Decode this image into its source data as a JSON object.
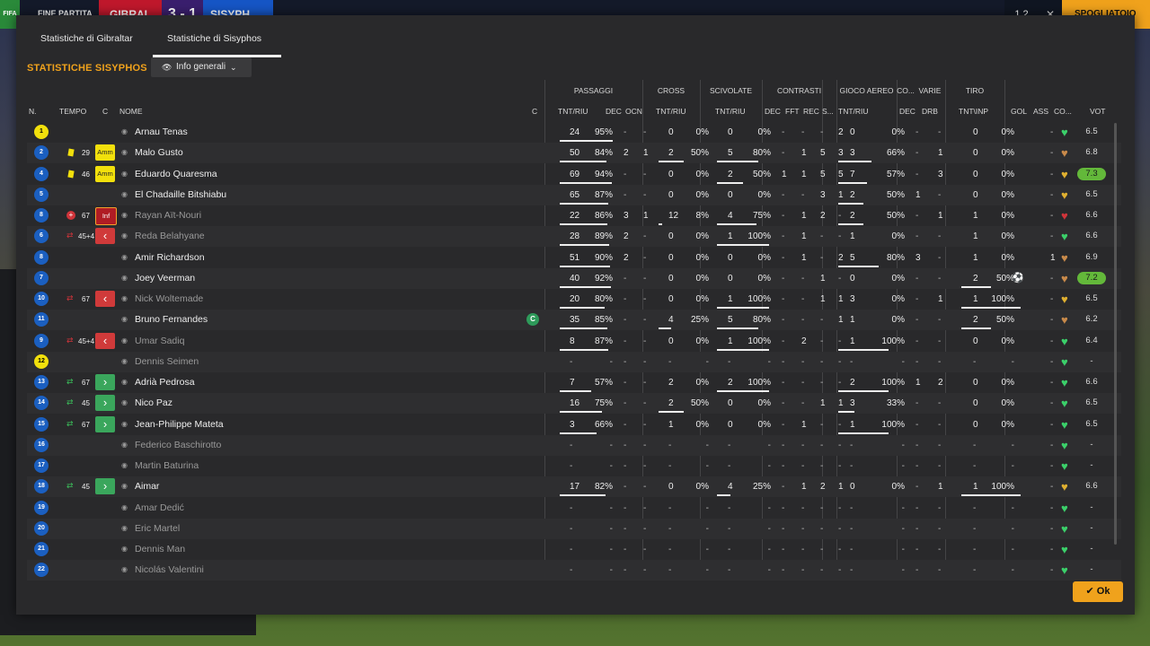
{
  "topbar": {
    "fifa": "FIFA",
    "match_label": "FINE PARTITA",
    "team1": "GIBRAL",
    "score": "3 - 1",
    "team2": "SISYPH",
    "btn1": "1 2",
    "close": "✕",
    "spogliatoio": "SPOGLIATOIO"
  },
  "tabs": [
    "Statistiche di Gibraltar",
    "Statistiche di Sisyphos"
  ],
  "stats_title": "STATISTICHE SISYPHOS",
  "view_dropdown": "Info generali",
  "groups": [
    "PASSAGGI",
    "CROSS",
    "SCIVOLATE",
    "CONTRASTI",
    "GIOCO AEREO",
    "CO...",
    "VARIE",
    "TIRO"
  ],
  "columns": [
    "N.",
    "TEMPO",
    "C",
    "NOME",
    "C",
    "TNT/RIU",
    "DEC",
    "OCN",
    "TNT/RIU",
    "TNT/RIU",
    "DEC",
    "FFT",
    "REC",
    "S...",
    "TNT/RIU",
    "DEC",
    "DRB",
    "TNT\\INP",
    "GOL",
    "ASS",
    "CO...",
    "VOT"
  ],
  "ok_label": "Ok",
  "colors": {
    "accent": "#f0a21c",
    "shirt_blue": "#1b5fc0",
    "goalkeeper": "#f2e00c",
    "rating_hi": "#63b83a"
  },
  "players": [
    {
      "num": "1",
      "gk": true,
      "time": "",
      "event": "",
      "badge": "",
      "name": "Arnau Tenas",
      "dim": false,
      "cap": false,
      "p_tnt": "24",
      "p_pct": "95%",
      "p_bar": 0.95,
      "p_dec": "-",
      "p_ocn": "-",
      "cr_tnt": "0",
      "cr_pct": "0%",
      "cr_bar": 0,
      "sc_tnt": "0",
      "sc_pct": "0%",
      "sc_bar": 0,
      "ct_dec": "-",
      "ct_fft": "-",
      "ct_rec": "-",
      "ct_s": "2",
      "ga_tnt": "0",
      "ga_pct": "0%",
      "ga_bar": 0,
      "co": "-",
      "drb": "-",
      "sh_tnt": "0",
      "sh_pct": "0%",
      "sh_bar": 0,
      "gol": "",
      "ass": "-",
      "heart": "#3bd06a",
      "vot": "6.5",
      "hi": false
    },
    {
      "num": "2",
      "gk": false,
      "time": "29",
      "event": "ycard",
      "badge": "Amm",
      "name": "Malo Gusto",
      "dim": false,
      "cap": false,
      "p_tnt": "50",
      "p_pct": "84%",
      "p_bar": 0.84,
      "p_dec": "2",
      "p_ocn": "1",
      "cr_tnt": "2",
      "cr_pct": "50%",
      "cr_bar": 0.5,
      "sc_tnt": "5",
      "sc_pct": "80%",
      "sc_bar": 0.8,
      "ct_dec": "-",
      "ct_fft": "1",
      "ct_rec": "5",
      "ct_s": "3",
      "ga_tnt": "3",
      "ga_pct": "66%",
      "ga_bar": 0.66,
      "co": "-",
      "drb": "1",
      "sh_tnt": "0",
      "sh_pct": "0%",
      "sh_bar": 0,
      "gol": "",
      "ass": "-",
      "heart": "#c98a4a",
      "vot": "6.8",
      "hi": false
    },
    {
      "num": "4",
      "gk": false,
      "time": "46",
      "event": "ycard",
      "badge": "Amm",
      "name": "Eduardo Quaresma",
      "dim": false,
      "cap": false,
      "p_tnt": "69",
      "p_pct": "94%",
      "p_bar": 0.94,
      "p_dec": "-",
      "p_ocn": "-",
      "cr_tnt": "0",
      "cr_pct": "0%",
      "cr_bar": 0,
      "sc_tnt": "2",
      "sc_pct": "50%",
      "sc_bar": 0.5,
      "ct_dec": "1",
      "ct_fft": "1",
      "ct_rec": "5",
      "ct_s": "5",
      "ga_tnt": "7",
      "ga_pct": "57%",
      "ga_bar": 0.57,
      "co": "-",
      "drb": "3",
      "sh_tnt": "0",
      "sh_pct": "0%",
      "sh_bar": 0,
      "gol": "",
      "ass": "-",
      "heart": "#e0b030",
      "vot": "7.3",
      "hi": true
    },
    {
      "num": "5",
      "gk": false,
      "time": "",
      "event": "",
      "badge": "",
      "name": "El Chadaille Bitshiabu",
      "dim": false,
      "cap": false,
      "p_tnt": "65",
      "p_pct": "87%",
      "p_bar": 0.87,
      "p_dec": "-",
      "p_ocn": "-",
      "cr_tnt": "0",
      "cr_pct": "0%",
      "cr_bar": 0,
      "sc_tnt": "0",
      "sc_pct": "0%",
      "sc_bar": 0,
      "ct_dec": "-",
      "ct_fft": "-",
      "ct_rec": "3",
      "ct_s": "1",
      "ga_tnt": "2",
      "ga_pct": "50%",
      "ga_bar": 0.5,
      "co": "1",
      "drb": "-",
      "sh_tnt": "0",
      "sh_pct": "0%",
      "sh_bar": 0,
      "gol": "",
      "ass": "-",
      "heart": "#e0b030",
      "vot": "6.5",
      "hi": false
    },
    {
      "num": "8",
      "gk": false,
      "time": "67",
      "event": "injury",
      "badge": "Inf",
      "name": "Rayan Aït-Nouri",
      "dim": true,
      "cap": false,
      "p_tnt": "22",
      "p_pct": "86%",
      "p_bar": 0.86,
      "p_dec": "3",
      "p_ocn": "1",
      "cr_tnt": "12",
      "cr_pct": "8%",
      "cr_bar": 0.08,
      "sc_tnt": "4",
      "sc_pct": "75%",
      "sc_bar": 0.75,
      "ct_dec": "-",
      "ct_fft": "1",
      "ct_rec": "2",
      "ct_s": "-",
      "ga_tnt": "2",
      "ga_pct": "50%",
      "ga_bar": 0.5,
      "co": "-",
      "drb": "1",
      "sh_tnt": "1",
      "sh_pct": "0%",
      "sh_bar": 0,
      "gol": "",
      "ass": "-",
      "heart": "#d0343a",
      "vot": "6.6",
      "hi": false
    },
    {
      "num": "6",
      "gk": false,
      "time": "45+4",
      "event": "out",
      "badge": "out",
      "name": "Reda Belahyane",
      "dim": true,
      "cap": false,
      "p_tnt": "28",
      "p_pct": "89%",
      "p_bar": 0.89,
      "p_dec": "2",
      "p_ocn": "-",
      "cr_tnt": "0",
      "cr_pct": "0%",
      "cr_bar": 0,
      "sc_tnt": "1",
      "sc_pct": "100%",
      "sc_bar": 1,
      "ct_dec": "-",
      "ct_fft": "1",
      "ct_rec": "-",
      "ct_s": "-",
      "ga_tnt": "1",
      "ga_pct": "0%",
      "ga_bar": 0,
      "co": "-",
      "drb": "-",
      "sh_tnt": "1",
      "sh_pct": "0%",
      "sh_bar": 0,
      "gol": "",
      "ass": "-",
      "heart": "#3bd06a",
      "vot": "6.6",
      "hi": false
    },
    {
      "num": "8",
      "gk": false,
      "time": "",
      "event": "",
      "badge": "",
      "name": "Amir Richardson",
      "dim": false,
      "cap": false,
      "p_tnt": "51",
      "p_pct": "90%",
      "p_bar": 0.9,
      "p_dec": "2",
      "p_ocn": "-",
      "cr_tnt": "0",
      "cr_pct": "0%",
      "cr_bar": 0,
      "sc_tnt": "0",
      "sc_pct": "0%",
      "sc_bar": 0,
      "ct_dec": "-",
      "ct_fft": "1",
      "ct_rec": "-",
      "ct_s": "2",
      "ga_tnt": "5",
      "ga_pct": "80%",
      "ga_bar": 0.8,
      "co": "3",
      "drb": "-",
      "sh_tnt": "1",
      "sh_pct": "0%",
      "sh_bar": 0,
      "gol": "",
      "ass": "1",
      "heart": "#c98a4a",
      "vot": "6.9",
      "hi": false
    },
    {
      "num": "7",
      "gk": false,
      "time": "",
      "event": "",
      "badge": "",
      "name": "Joey Veerman",
      "dim": false,
      "cap": false,
      "p_tnt": "40",
      "p_pct": "92%",
      "p_bar": 0.92,
      "p_dec": "-",
      "p_ocn": "-",
      "cr_tnt": "0",
      "cr_pct": "0%",
      "cr_bar": 0,
      "sc_tnt": "0",
      "sc_pct": "0%",
      "sc_bar": 0,
      "ct_dec": "-",
      "ct_fft": "-",
      "ct_rec": "1",
      "ct_s": "-",
      "ga_tnt": "0",
      "ga_pct": "0%",
      "ga_bar": 0,
      "co": "-",
      "drb": "-",
      "sh_tnt": "2",
      "sh_pct": "50%",
      "sh_bar": 0.5,
      "gol": "ball",
      "ass": "-",
      "heart": "#c98a4a",
      "vot": "7.2",
      "hi": true
    },
    {
      "num": "10",
      "gk": false,
      "time": "67",
      "event": "out",
      "badge": "out",
      "name": "Nick Woltemade",
      "dim": true,
      "cap": false,
      "p_tnt": "20",
      "p_pct": "80%",
      "p_bar": 0.8,
      "p_dec": "-",
      "p_ocn": "-",
      "cr_tnt": "0",
      "cr_pct": "0%",
      "cr_bar": 0,
      "sc_tnt": "1",
      "sc_pct": "100%",
      "sc_bar": 1,
      "ct_dec": "-",
      "ct_fft": "-",
      "ct_rec": "1",
      "ct_s": "1",
      "ga_tnt": "3",
      "ga_pct": "0%",
      "ga_bar": 0,
      "co": "-",
      "drb": "1",
      "sh_tnt": "1",
      "sh_pct": "100%",
      "sh_bar": 1,
      "gol": "",
      "ass": "-",
      "heart": "#e0b030",
      "vot": "6.5",
      "hi": false
    },
    {
      "num": "11",
      "gk": false,
      "time": "",
      "event": "",
      "badge": "",
      "name": "Bruno Fernandes",
      "dim": false,
      "cap": true,
      "p_tnt": "35",
      "p_pct": "85%",
      "p_bar": 0.85,
      "p_dec": "-",
      "p_ocn": "-",
      "cr_tnt": "4",
      "cr_pct": "25%",
      "cr_bar": 0.25,
      "sc_tnt": "5",
      "sc_pct": "80%",
      "sc_bar": 0.8,
      "ct_dec": "-",
      "ct_fft": "-",
      "ct_rec": "-",
      "ct_s": "1",
      "ga_tnt": "1",
      "ga_pct": "0%",
      "ga_bar": 0,
      "co": "-",
      "drb": "-",
      "sh_tnt": "2",
      "sh_pct": "50%",
      "sh_bar": 0.5,
      "gol": "",
      "ass": "-",
      "heart": "#c98a4a",
      "vot": "6.2",
      "hi": false
    },
    {
      "num": "9",
      "gk": false,
      "time": "45+4",
      "event": "out",
      "badge": "out",
      "name": "Umar Sadiq",
      "dim": true,
      "cap": false,
      "p_tnt": "8",
      "p_pct": "87%",
      "p_bar": 0.87,
      "p_dec": "-",
      "p_ocn": "-",
      "cr_tnt": "0",
      "cr_pct": "0%",
      "cr_bar": 0,
      "sc_tnt": "1",
      "sc_pct": "100%",
      "sc_bar": 1,
      "ct_dec": "-",
      "ct_fft": "2",
      "ct_rec": "-",
      "ct_s": "-",
      "ga_tnt": "1",
      "ga_pct": "100%",
      "ga_bar": 1,
      "co": "-",
      "drb": "-",
      "sh_tnt": "0",
      "sh_pct": "0%",
      "sh_bar": 0,
      "gol": "",
      "ass": "-",
      "heart": "#3bd06a",
      "vot": "6.4",
      "hi": false
    },
    {
      "num": "12",
      "gk": true,
      "time": "",
      "event": "",
      "badge": "",
      "name": "Dennis Seimen",
      "dim": true,
      "cap": false,
      "p_tnt": "-",
      "p_pct": "-",
      "p_bar": 0,
      "p_dec": "-",
      "p_ocn": "-",
      "cr_tnt": "-",
      "cr_pct": "-",
      "cr_bar": 0,
      "sc_tnt": "-",
      "sc_pct": "-",
      "sc_bar": 0,
      "ct_dec": "-",
      "ct_fft": "-",
      "ct_rec": "-",
      "ct_s": "-",
      "ga_tnt": "-",
      "ga_pct": "-",
      "ga_bar": 0,
      "co": "-",
      "drb": "-",
      "sh_tnt": "-",
      "sh_pct": "-",
      "sh_bar": 0,
      "gol": "",
      "ass": "-",
      "heart": "#3bd06a",
      "vot": "-",
      "hi": false
    },
    {
      "num": "13",
      "gk": false,
      "time": "67",
      "event": "in",
      "badge": "in",
      "name": "Adrià Pedrosa",
      "dim": false,
      "cap": false,
      "p_tnt": "7",
      "p_pct": "57%",
      "p_bar": 0.57,
      "p_dec": "-",
      "p_ocn": "-",
      "cr_tnt": "2",
      "cr_pct": "0%",
      "cr_bar": 0,
      "sc_tnt": "2",
      "sc_pct": "100%",
      "sc_bar": 1,
      "ct_dec": "-",
      "ct_fft": "-",
      "ct_rec": "-",
      "ct_s": "-",
      "ga_tnt": "2",
      "ga_pct": "100%",
      "ga_bar": 1,
      "co": "1",
      "drb": "2",
      "sh_tnt": "0",
      "sh_pct": "0%",
      "sh_bar": 0,
      "gol": "",
      "ass": "-",
      "heart": "#3bd06a",
      "vot": "6.6",
      "hi": false
    },
    {
      "num": "14",
      "gk": false,
      "time": "45",
      "event": "in",
      "badge": "in",
      "name": "Nico Paz",
      "dim": false,
      "cap": false,
      "p_tnt": "16",
      "p_pct": "75%",
      "p_bar": 0.75,
      "p_dec": "-",
      "p_ocn": "-",
      "cr_tnt": "2",
      "cr_pct": "50%",
      "cr_bar": 0.5,
      "sc_tnt": "0",
      "sc_pct": "0%",
      "sc_bar": 0,
      "ct_dec": "-",
      "ct_fft": "-",
      "ct_rec": "1",
      "ct_s": "1",
      "ga_tnt": "3",
      "ga_pct": "33%",
      "ga_bar": 0.33,
      "co": "-",
      "drb": "-",
      "sh_tnt": "0",
      "sh_pct": "0%",
      "sh_bar": 0,
      "gol": "",
      "ass": "-",
      "heart": "#3bd06a",
      "vot": "6.5",
      "hi": false
    },
    {
      "num": "15",
      "gk": false,
      "time": "67",
      "event": "in",
      "badge": "in",
      "name": "Jean-Philippe Mateta",
      "dim": false,
      "cap": false,
      "p_tnt": "3",
      "p_pct": "66%",
      "p_bar": 0.66,
      "p_dec": "-",
      "p_ocn": "-",
      "cr_tnt": "1",
      "cr_pct": "0%",
      "cr_bar": 0,
      "sc_tnt": "0",
      "sc_pct": "0%",
      "sc_bar": 0,
      "ct_dec": "-",
      "ct_fft": "1",
      "ct_rec": "-",
      "ct_s": "-",
      "ga_tnt": "1",
      "ga_pct": "100%",
      "ga_bar": 1,
      "co": "-",
      "drb": "-",
      "sh_tnt": "0",
      "sh_pct": "0%",
      "sh_bar": 0,
      "gol": "",
      "ass": "-",
      "heart": "#3bd06a",
      "vot": "6.5",
      "hi": false
    },
    {
      "num": "16",
      "gk": false,
      "time": "",
      "event": "",
      "badge": "",
      "name": "Federico Baschirotto",
      "dim": true,
      "cap": false,
      "p_tnt": "-",
      "p_pct": "-",
      "p_bar": 0,
      "p_dec": "-",
      "p_ocn": "-",
      "cr_tnt": "-",
      "cr_pct": "-",
      "cr_bar": 0,
      "sc_tnt": "-",
      "sc_pct": "-",
      "sc_bar": 0,
      "ct_dec": "-",
      "ct_fft": "-",
      "ct_rec": "-",
      "ct_s": "-",
      "ga_tnt": "-",
      "ga_pct": "-",
      "ga_bar": 0,
      "co": "-",
      "drb": "-",
      "sh_tnt": "-",
      "sh_pct": "-",
      "sh_bar": 0,
      "gol": "",
      "ass": "-",
      "heart": "#3bd06a",
      "vot": "-",
      "hi": false
    },
    {
      "num": "17",
      "gk": false,
      "time": "",
      "event": "",
      "badge": "",
      "name": "Martin Baturina",
      "dim": true,
      "cap": false,
      "p_tnt": "-",
      "p_pct": "-",
      "p_bar": 0,
      "p_dec": "-",
      "p_ocn": "-",
      "cr_tnt": "-",
      "cr_pct": "-",
      "cr_bar": 0,
      "sc_tnt": "-",
      "sc_pct": "-",
      "sc_bar": 0,
      "ct_dec": "-",
      "ct_fft": "-",
      "ct_rec": "-",
      "ct_s": "-",
      "ga_tnt": "-",
      "ga_pct": "-",
      "ga_bar": 0,
      "co": "-",
      "drb": "-",
      "sh_tnt": "-",
      "sh_pct": "-",
      "sh_bar": 0,
      "gol": "",
      "ass": "-",
      "heart": "#3bd06a",
      "vot": "-",
      "hi": false
    },
    {
      "num": "18",
      "gk": false,
      "time": "45",
      "event": "in",
      "badge": "in",
      "name": "Aimar",
      "dim": false,
      "cap": false,
      "p_tnt": "17",
      "p_pct": "82%",
      "p_bar": 0.82,
      "p_dec": "-",
      "p_ocn": "-",
      "cr_tnt": "0",
      "cr_pct": "0%",
      "cr_bar": 0,
      "sc_tnt": "4",
      "sc_pct": "25%",
      "sc_bar": 0.25,
      "ct_dec": "-",
      "ct_fft": "1",
      "ct_rec": "2",
      "ct_s": "1",
      "ga_tnt": "0",
      "ga_pct": "0%",
      "ga_bar": 0,
      "co": "-",
      "drb": "1",
      "sh_tnt": "1",
      "sh_pct": "100%",
      "sh_bar": 1,
      "gol": "",
      "ass": "-",
      "heart": "#e0b030",
      "vot": "6.6",
      "hi": false
    },
    {
      "num": "19",
      "gk": false,
      "time": "",
      "event": "",
      "badge": "",
      "name": "Amar Dedić",
      "dim": true,
      "cap": false,
      "p_tnt": "-",
      "p_pct": "-",
      "p_bar": 0,
      "p_dec": "-",
      "p_ocn": "-",
      "cr_tnt": "-",
      "cr_pct": "-",
      "cr_bar": 0,
      "sc_tnt": "-",
      "sc_pct": "-",
      "sc_bar": 0,
      "ct_dec": "-",
      "ct_fft": "-",
      "ct_rec": "-",
      "ct_s": "-",
      "ga_tnt": "-",
      "ga_pct": "-",
      "ga_bar": 0,
      "co": "-",
      "drb": "-",
      "sh_tnt": "-",
      "sh_pct": "-",
      "sh_bar": 0,
      "gol": "",
      "ass": "-",
      "heart": "#3bd06a",
      "vot": "-",
      "hi": false
    },
    {
      "num": "20",
      "gk": false,
      "time": "",
      "event": "",
      "badge": "",
      "name": "Eric Martel",
      "dim": true,
      "cap": false,
      "p_tnt": "-",
      "p_pct": "-",
      "p_bar": 0,
      "p_dec": "-",
      "p_ocn": "-",
      "cr_tnt": "-",
      "cr_pct": "-",
      "cr_bar": 0,
      "sc_tnt": "-",
      "sc_pct": "-",
      "sc_bar": 0,
      "ct_dec": "-",
      "ct_fft": "-",
      "ct_rec": "-",
      "ct_s": "-",
      "ga_tnt": "-",
      "ga_pct": "-",
      "ga_bar": 0,
      "co": "-",
      "drb": "-",
      "sh_tnt": "-",
      "sh_pct": "-",
      "sh_bar": 0,
      "gol": "",
      "ass": "-",
      "heart": "#3bd06a",
      "vot": "-",
      "hi": false
    },
    {
      "num": "21",
      "gk": false,
      "time": "",
      "event": "",
      "badge": "",
      "name": "Dennis Man",
      "dim": true,
      "cap": false,
      "p_tnt": "-",
      "p_pct": "-",
      "p_bar": 0,
      "p_dec": "-",
      "p_ocn": "-",
      "cr_tnt": "-",
      "cr_pct": "-",
      "cr_bar": 0,
      "sc_tnt": "-",
      "sc_pct": "-",
      "sc_bar": 0,
      "ct_dec": "-",
      "ct_fft": "-",
      "ct_rec": "-",
      "ct_s": "-",
      "ga_tnt": "-",
      "ga_pct": "-",
      "ga_bar": 0,
      "co": "-",
      "drb": "-",
      "sh_tnt": "-",
      "sh_pct": "-",
      "sh_bar": 0,
      "gol": "",
      "ass": "-",
      "heart": "#3bd06a",
      "vot": "-",
      "hi": false
    },
    {
      "num": "22",
      "gk": false,
      "time": "",
      "event": "",
      "badge": "",
      "name": "Nicolás Valentini",
      "dim": true,
      "cap": false,
      "p_tnt": "-",
      "p_pct": "-",
      "p_bar": 0,
      "p_dec": "-",
      "p_ocn": "-",
      "cr_tnt": "-",
      "cr_pct": "-",
      "cr_bar": 0,
      "sc_tnt": "-",
      "sc_pct": "-",
      "sc_bar": 0,
      "ct_dec": "-",
      "ct_fft": "-",
      "ct_rec": "-",
      "ct_s": "-",
      "ga_tnt": "-",
      "ga_pct": "-",
      "ga_bar": 0,
      "co": "-",
      "drb": "-",
      "sh_tnt": "-",
      "sh_pct": "-",
      "sh_bar": 0,
      "gol": "",
      "ass": "-",
      "heart": "#3bd06a",
      "vot": "-",
      "hi": false
    }
  ]
}
